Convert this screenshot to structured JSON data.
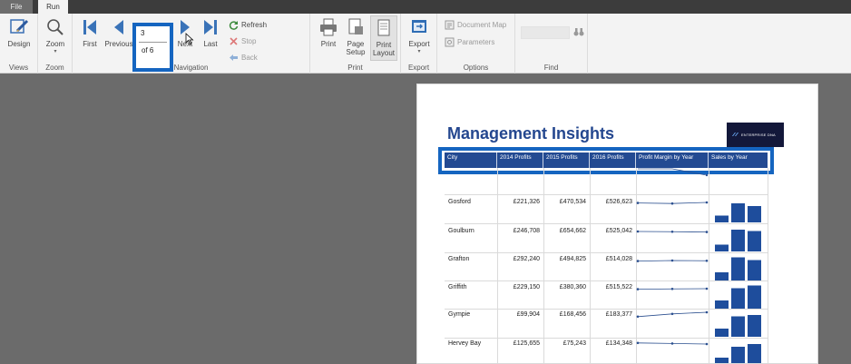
{
  "tabs": [
    {
      "label": "File"
    },
    {
      "label": "Run"
    }
  ],
  "ribbon": {
    "views": {
      "design_label": "Design",
      "group_label": "Views"
    },
    "zoom": {
      "zoom_label": "Zoom",
      "group_label": "Zoom"
    },
    "navigation": {
      "first_label": "First",
      "previous_label": "Previous",
      "current_page": "3",
      "page_total": "of 6",
      "next_label": "Next",
      "last_label": "Last",
      "refresh_label": "Refresh",
      "stop_label": "Stop",
      "back_label": "Back",
      "group_label": "Navigation"
    },
    "print": {
      "print_label": "Print",
      "page_setup_label": "Page Setup",
      "print_layout_label": "Print Layout",
      "group_label": "Print"
    },
    "export": {
      "export_label": "Export",
      "group_label": "Export"
    },
    "options": {
      "document_map_label": "Document Map",
      "parameters_label": "Parameters",
      "group_label": "Options"
    },
    "find": {
      "group_label": "Find"
    }
  },
  "report": {
    "title": "Management Insights",
    "logo_text": "ENTERPRISE DNA",
    "columns": [
      "City",
      "2014 Profits",
      "2015 Profits",
      "2016 Profits",
      "Profit Margin by Year",
      "Sales by Year"
    ],
    "rows": [
      {
        "city": "Gosford",
        "p2014": "£221,326",
        "p2015": "£470,534",
        "p2016": "£526,623",
        "margin": [
          0.45,
          0.4,
          0.5
        ],
        "sales": [
          0.25,
          0.7,
          0.6
        ]
      },
      {
        "city": "Goulburn",
        "p2014": "£246,708",
        "p2015": "£654,662",
        "p2016": "£525,042",
        "margin": [
          0.5,
          0.48,
          0.45
        ],
        "sales": [
          0.25,
          0.8,
          0.75
        ]
      },
      {
        "city": "Grafton",
        "p2014": "£292,240",
        "p2015": "£494,825",
        "p2016": "£514,028",
        "margin": [
          0.45,
          0.5,
          0.48
        ],
        "sales": [
          0.3,
          0.85,
          0.75
        ]
      },
      {
        "city": "Griffith",
        "p2014": "£229,150",
        "p2015": "£380,360",
        "p2016": "£515,522",
        "margin": [
          0.45,
          0.48,
          0.5
        ],
        "sales": [
          0.3,
          0.75,
          0.85
        ]
      },
      {
        "city": "Gympie",
        "p2014": "£99,904",
        "p2015": "£168,456",
        "p2016": "£183,377",
        "margin": [
          0.35,
          0.6,
          0.75
        ],
        "sales": [
          0.3,
          0.75,
          0.8
        ]
      },
      {
        "city": "Hervey Bay",
        "p2014": "£125,655",
        "p2015": "£75,243",
        "p2016": "£134,348",
        "margin": [
          0.6,
          0.55,
          0.5
        ],
        "sales": [
          0.3,
          0.7,
          0.8
        ]
      }
    ]
  },
  "colors": {
    "accent": "#1565c0",
    "header": "#234a92",
    "bar": "#1e4d9c",
    "line": "#2b4f8f"
  }
}
